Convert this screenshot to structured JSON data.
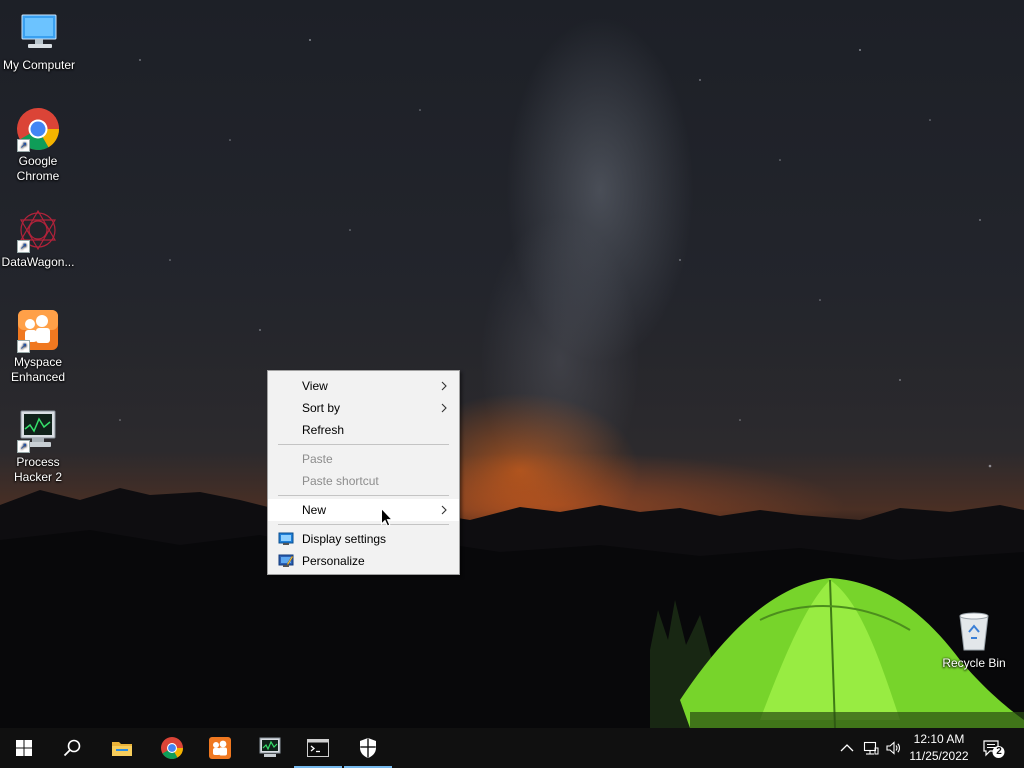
{
  "desktop": {
    "icons": [
      {
        "label": "My Computer"
      },
      {
        "label": "Google\nChrome"
      },
      {
        "label": "DataWagon..."
      },
      {
        "label": "Myspace\nEnhanced"
      },
      {
        "label": "Process\nHacker 2"
      },
      {
        "label": "Recycle Bin"
      }
    ]
  },
  "context_menu": {
    "items": [
      {
        "label": "View",
        "has_submenu": true,
        "enabled": true
      },
      {
        "label": "Sort by",
        "has_submenu": true,
        "enabled": true
      },
      {
        "label": "Refresh",
        "enabled": true
      },
      {
        "label": "Paste",
        "enabled": false
      },
      {
        "label": "Paste shortcut",
        "enabled": false
      },
      {
        "label": "New",
        "has_submenu": true,
        "enabled": true,
        "highlighted": true
      },
      {
        "label": "Display settings",
        "icon": "display-icon",
        "enabled": true
      },
      {
        "label": "Personalize",
        "icon": "personalize-icon",
        "enabled": true
      }
    ]
  },
  "taskbar": {
    "buttons": [
      {
        "icon": "windows-start-icon"
      },
      {
        "icon": "search-icon"
      },
      {
        "icon": "file-explorer-icon"
      },
      {
        "icon": "chrome-icon"
      },
      {
        "icon": "myspace-icon"
      },
      {
        "icon": "process-hacker-icon"
      },
      {
        "icon": "command-prompt-icon",
        "active": true
      },
      {
        "icon": "windows-security-icon",
        "active": true
      }
    ],
    "tray": {
      "icons": [
        "chevron-up-icon",
        "network-icon",
        "volume-icon"
      ],
      "time": "12:10 AM",
      "date": "11/25/2022",
      "notification_count": "2"
    }
  },
  "colors": {
    "taskbar": "#101010",
    "menu_bg": "#f2f2f2",
    "active_indicator": "#76b9ed",
    "disabled_text": "#8d8d8d"
  }
}
